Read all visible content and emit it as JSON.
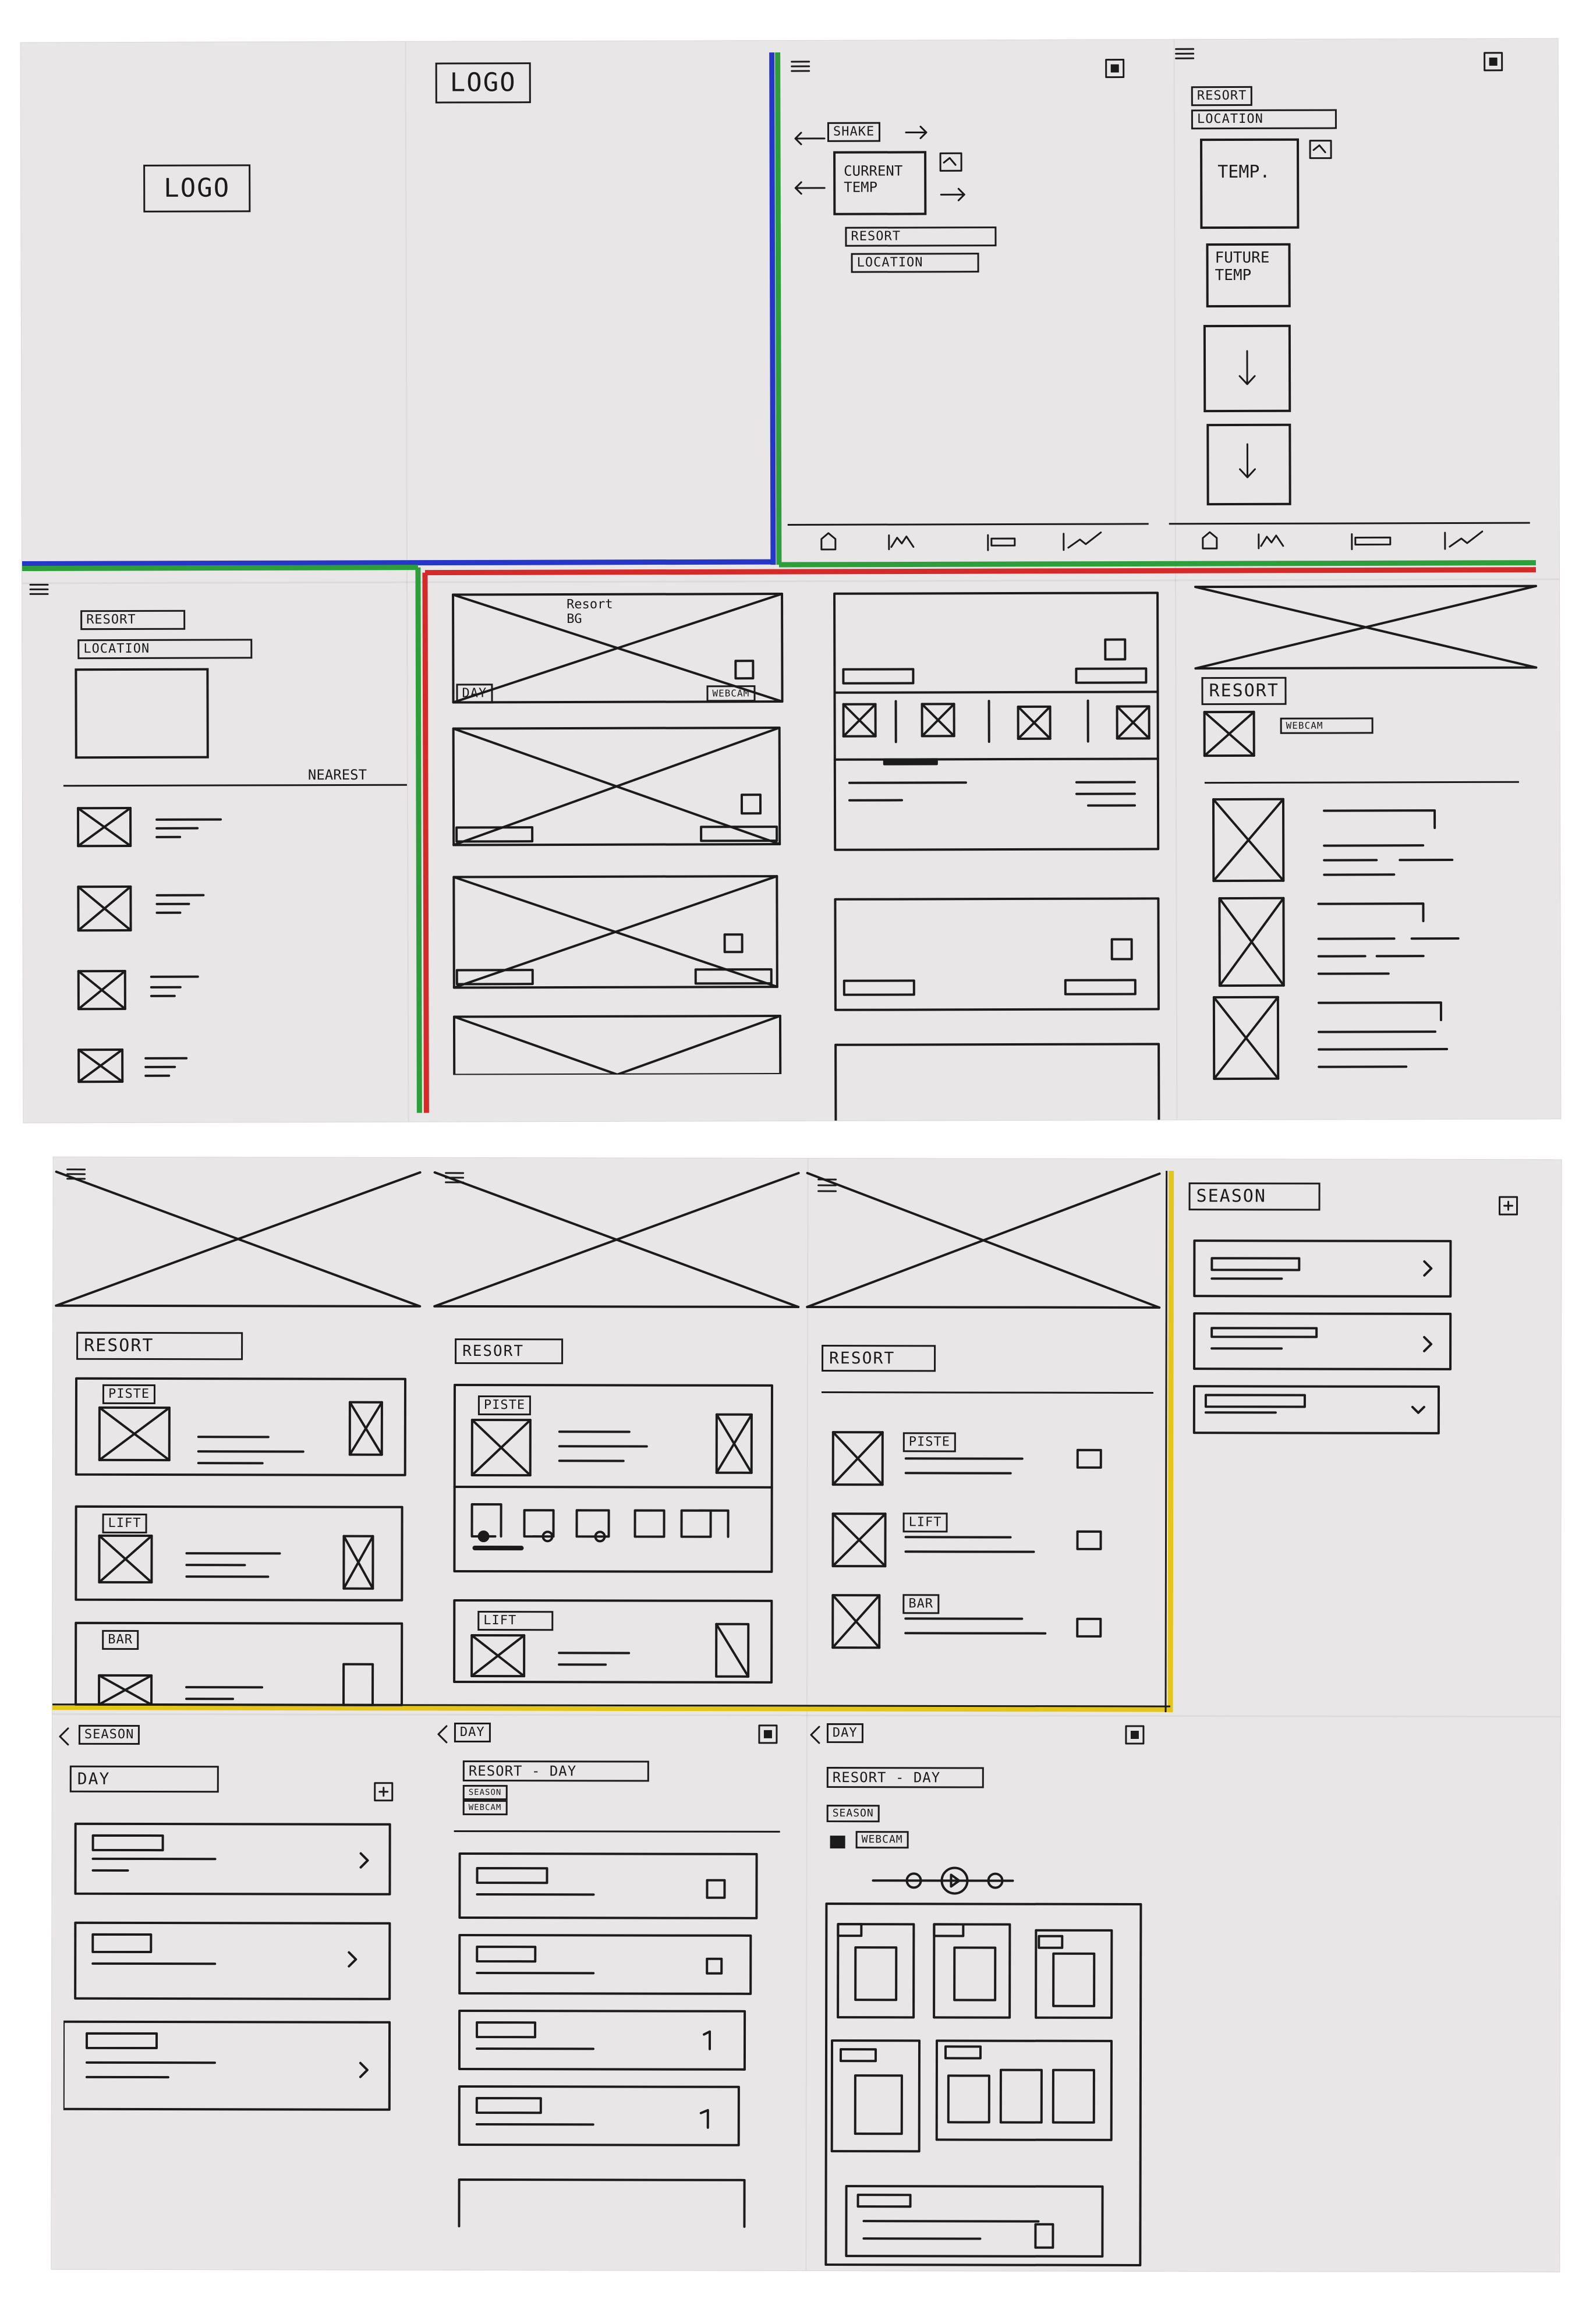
{
  "top_sheet": {
    "splash": {
      "logo_large": "LOGO",
      "logo_small": "LOGO"
    },
    "home": {
      "label_1": "SHAKE",
      "temp_label": "CURRENT\nTEMP",
      "resort": "RESORT",
      "location": "LOCATION"
    },
    "overview": {
      "resort": "RESORT",
      "location": "LOCATION",
      "temp": "TEMP.",
      "future_temp": "FUTURE\nTEMP"
    },
    "nearby": {
      "resort": "RESORT",
      "location": "LOCATION",
      "nearest": "NEAREST"
    },
    "feed": {
      "bg_note": "Resort\nBG",
      "day": "DAY",
      "button": "WEBCAM"
    },
    "resort_detail": {
      "resort": "RESORT",
      "button": "WEBCAM"
    }
  },
  "bottom_sheet": {
    "resort_a": {
      "title": "RESORT",
      "card_1": "PISTE",
      "card_2": "LIFT",
      "card_3": "BAR"
    },
    "resort_b": {
      "title": "RESORT",
      "card_1": "PISTE",
      "card_2": "LIFT"
    },
    "resort_c": {
      "title": "RESORT",
      "item_1": "PISTE",
      "item_2": "LIFT",
      "item_3": "BAR"
    },
    "season": {
      "title": "SEASON"
    },
    "day_list": {
      "back": "SEASON",
      "title": "DAY"
    },
    "resort_day": {
      "back": "DAY",
      "title": "RESORT - DAY",
      "sub_1": "SEASON",
      "sub_2": "WEBCAM"
    },
    "resort_day_2": {
      "back": "DAY",
      "title": "RESORT - DAY",
      "sub_1": "SEASON",
      "sub_2": "WEBCAM"
    }
  },
  "colors": {
    "paper": "#e8e6e6",
    "ink": "#1b1b1b",
    "blue": "#2536c8",
    "green": "#2e9e3a",
    "red": "#d42a2a",
    "yellow": "#e5c518"
  }
}
